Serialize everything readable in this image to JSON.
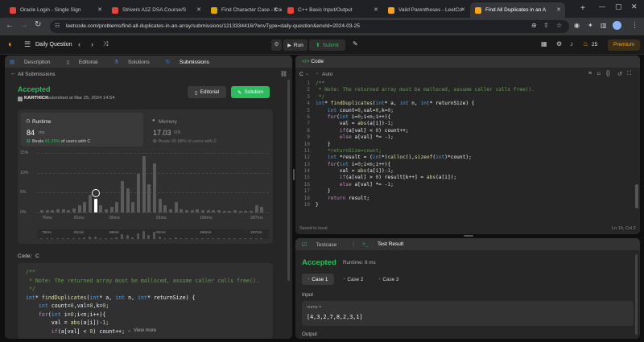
{
  "tabs": [
    {
      "title": "Oracle Login - Single Sign",
      "fav": "#ea4335",
      "active": false
    },
    {
      "title": "Strivers A2Z DSA Course/S",
      "fav": "#ea4335",
      "active": false
    },
    {
      "title": "Find Character Case - Cod",
      "fav": "#e0a800",
      "active": false
    },
    {
      "title": "C++ Basic Input/Output",
      "fav": "#ea4335",
      "active": false
    },
    {
      "title": "Valid Parentheses - LeetCo",
      "fav": "#ffa116",
      "active": false
    },
    {
      "title": "Find All Duplicates in an A",
      "fav": "#ffa116",
      "active": true
    }
  ],
  "url": "leetcode.com/problems/find-all-duplicates-in-an-array/submissions/1213334416/?envType=daily-question&envId=2024-03-25",
  "nav": {
    "daily": "Daily Question",
    "run": "Run",
    "submit": "Submit",
    "streak": "25",
    "premium": "Premium"
  },
  "left_tabs": [
    "Description",
    "Editorial",
    "Solutions",
    "Submissions"
  ],
  "all_submissions": "All Submissions",
  "status": "Accepted",
  "user": "KARTHICK",
  "submitted": "submitted at Mar 25, 2024 14:54",
  "buttons": {
    "editorial": "Editorial",
    "solution": "Solution",
    "view_more": "View more"
  },
  "runtime": {
    "label": "Runtime",
    "value": "84",
    "unit": "ms",
    "beats": "Beats",
    "pct": "81.25%",
    "tail": "of users with C"
  },
  "memory": {
    "label": "Memory",
    "value": "17.03",
    "unit": "MB",
    "beats": "Beats",
    "pct": "95.88%",
    "tail": "of users with C"
  },
  "chart_data": {
    "type": "bar",
    "yticks": [
      "15%",
      "10%",
      "5%",
      "0%"
    ],
    "xticks": [
      "76ms",
      "81ms",
      "86ms",
      "91ms",
      "196ms",
      "287ms"
    ],
    "values": [
      0.8,
      0.8,
      0.8,
      1,
      1,
      0.8,
      1.2,
      2,
      3,
      5,
      4,
      2,
      1,
      1.5,
      3,
      9,
      7,
      3,
      11,
      16,
      8,
      14,
      4,
      2,
      1,
      3,
      1,
      0.8,
      0.8,
      1,
      0.8,
      0.8,
      0.8,
      0.8,
      0.5,
      0.5,
      0.8,
      0.5,
      0.5,
      0.5,
      2,
      1.5
    ],
    "highlight_index": 10,
    "ymax": 17
  },
  "minimap_ticks": [
    "76ms",
    "81ms",
    "86ms",
    "91ms",
    "196ms",
    "287ms"
  ],
  "code_label": "Code",
  "lang": "C",
  "code_preview": [
    "/**",
    " * Note: The returned array must be malloced, assume caller calls free().",
    " */",
    "int* findDuplicates(int* a, int n, int* returnSize) {",
    "    int count=0,val=0,k=0;",
    "    for(int i=0;i<n;i++){",
    "        val = abs(a[i])-1;",
    "        if(a[val] < 0) count++;"
  ],
  "editor": {
    "title": "Code",
    "lang": "C",
    "auto": "Auto",
    "saved": "Saved to local",
    "pos": "Ln 19, Col 2",
    "lines": [
      "/**",
      " * Note: The returned array must be malloced, assume caller calls free().",
      " */",
      "int* findDuplicates(int* a, int n, int* returnSize) {",
      "    int count=0,val=0,k=0;",
      "    for(int i=0;i<n;i++){",
      "        val = abs(a[i])-1;",
      "        if(a[val] < 0) count++;",
      "        else a[val] *= -1;",
      "    }",
      "    *returnSize=count;",
      "    int *result = (int*)calloc(1,sizeof(int)*count);",
      "    for(int i=0;i<n;i++){",
      "        val = abs(a[i])-1;",
      "        if(a[val] > 0) result[k++] = abs(a[i]);",
      "        else a[val] *= -1;",
      "    }",
      "    return result;",
      "}"
    ]
  },
  "result": {
    "tab_testcase": "Testcase",
    "tab_result": "Test Result",
    "status": "Accepted",
    "runtime": "Runtime: 6 ms",
    "cases": [
      "Case 1",
      "Case 2",
      "Case 3"
    ],
    "input_label": "Input",
    "var": "nums =",
    "value": "[4,3,2,7,8,2,3,1]",
    "output_label": "Output"
  },
  "colors": {
    "accent": "#2cbb5d",
    "orange": "#ffa116",
    "bg": "#1a1a1a"
  }
}
